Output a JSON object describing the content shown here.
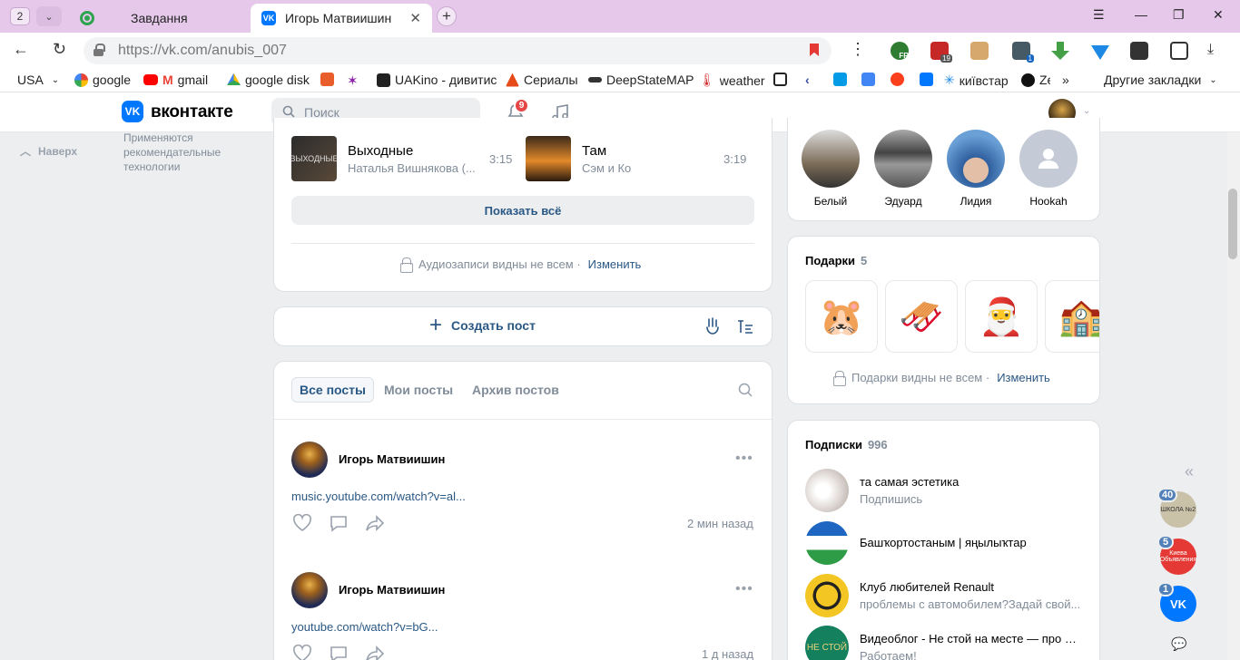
{
  "browser": {
    "tab_count": "2",
    "tabs": [
      {
        "title": "Завдання"
      },
      {
        "title": "Игорь Матвиишин"
      }
    ],
    "url": "https://vk.com/anubis_007",
    "bookmarks": [
      "USA",
      "google",
      "gmail",
      "google disk",
      "UAKino - дивитис",
      "Сериалы",
      "DeepStateMAP",
      "weather",
      "київстар",
      "Ze"
    ],
    "other_bookmarks": "Другие закладки",
    "ext_badge_1": "19",
    "ext_badge_2": "1",
    "ext_fr": "FR"
  },
  "header": {
    "logo": "вконтакте",
    "search_placeholder": "Поиск",
    "notifications_count": "9"
  },
  "left": {
    "up_label": "Наверх",
    "recommend_text": "Применяются рекомендательные технологии"
  },
  "audio": {
    "tracks": [
      {
        "title": "Выходные",
        "artist": "Наталья Вишнякова (...",
        "duration": "3:15"
      },
      {
        "title": "Там",
        "artist": "Сэм и Ко",
        "duration": "3:19"
      }
    ],
    "show_all": "Показать всё",
    "privacy": "Аудиозаписи видны не всем ·",
    "change": "Изменить"
  },
  "create_post": {
    "label": "Создать пост"
  },
  "feed": {
    "tabs": [
      "Все посты",
      "Мои посты",
      "Архив постов"
    ],
    "posts": [
      {
        "author": "Игорь Матвиишин",
        "link": "music.youtube.com/watch?v=al...",
        "time": "2 мин назад"
      },
      {
        "author": "Игорь Матвиишин",
        "link": "youtube.com/watch?v=bG...",
        "time": "1 д назад"
      }
    ]
  },
  "friends": [
    {
      "name": "Белый"
    },
    {
      "name": "Эдуард"
    },
    {
      "name": "Лидия"
    },
    {
      "name": "Hookah"
    }
  ],
  "gifts": {
    "title": "Подарки",
    "count": "5",
    "privacy": "Подарки видны не всем ·",
    "change": "Изменить"
  },
  "subscriptions": {
    "title": "Подписки",
    "count": "996",
    "items": [
      {
        "name": "та самая эстетика",
        "desc": "Подпишись"
      },
      {
        "name": "Башҡортостаным | яңылыҡтар",
        "desc": ""
      },
      {
        "name": "Клуб любителей Renault",
        "desc": "проблемы с автомобилем?Задай свой..."
      },
      {
        "name": "Видеоблог - Не стой на месте — про би...",
        "desc": "Работаем!"
      }
    ]
  },
  "chats": [
    {
      "badge": "40",
      "label": "ШКОЛА №2"
    },
    {
      "badge": "5",
      "label": "Киева Объявления"
    },
    {
      "badge": "1",
      "label": "VK"
    }
  ],
  "colors": {
    "vk_blue": "#0077ff",
    "link": "#2a5885",
    "tabbar": "#e5c8ea"
  }
}
